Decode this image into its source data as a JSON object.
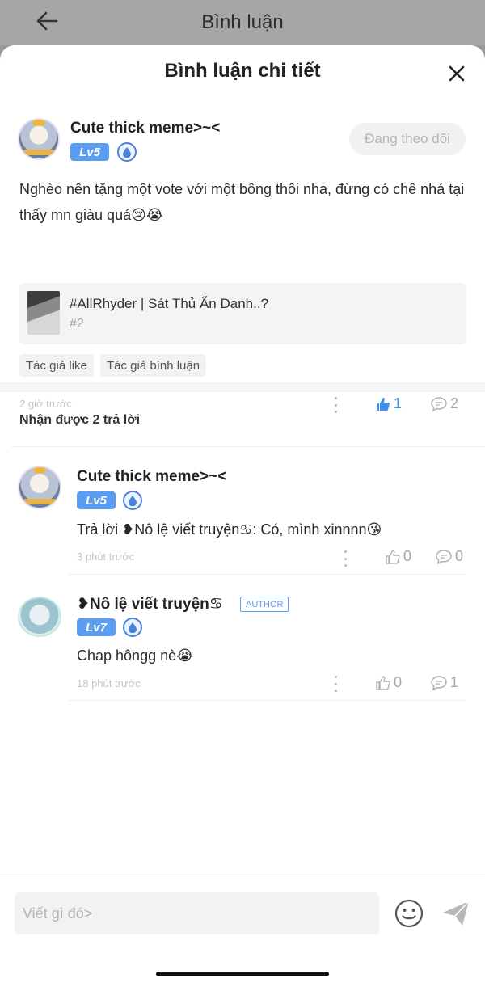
{
  "background_header": {
    "title": "Bình luận"
  },
  "sheet": {
    "title": "Bình luận chi tiết"
  },
  "main_comment": {
    "username": "Cute thick meme>~<",
    "level": "Lv5",
    "follow_label": "Đang theo dõi",
    "text": "Nghèo nên tặng một vote với một bông thôi nha, đừng có chê nhá tại thấy mn giàu quá😢😭",
    "story": {
      "title": "#AllRhyder | Sát Thủ Ẩn Danh..?",
      "chapter": "#2"
    },
    "tags": [
      "Tác giả like",
      "Tác giả bình luận"
    ],
    "time": "2 giờ trước",
    "likes": "1",
    "comments": "2"
  },
  "replies_header": "Nhận được 2 trả lời",
  "replies": [
    {
      "username": "Cute thick meme>~<",
      "level": "Lv5",
      "text": "Trả lời ❥Nô lệ viết truyện♋: Có, mình xinnnn😘",
      "time": "3 phút trước",
      "likes": "0",
      "comments": "0"
    },
    {
      "username": "❥Nô lệ viết truyện♋",
      "author_badge": "AUTHOR",
      "level": "Lv7",
      "text": "Chap hôngg nè😭",
      "time": "18 phút trước",
      "likes": "0",
      "comments": "1"
    }
  ],
  "composer": {
    "placeholder": "Viết gì đó>"
  },
  "colors": {
    "accent": "#5b9df0",
    "like_active": "#3f8ee8"
  }
}
